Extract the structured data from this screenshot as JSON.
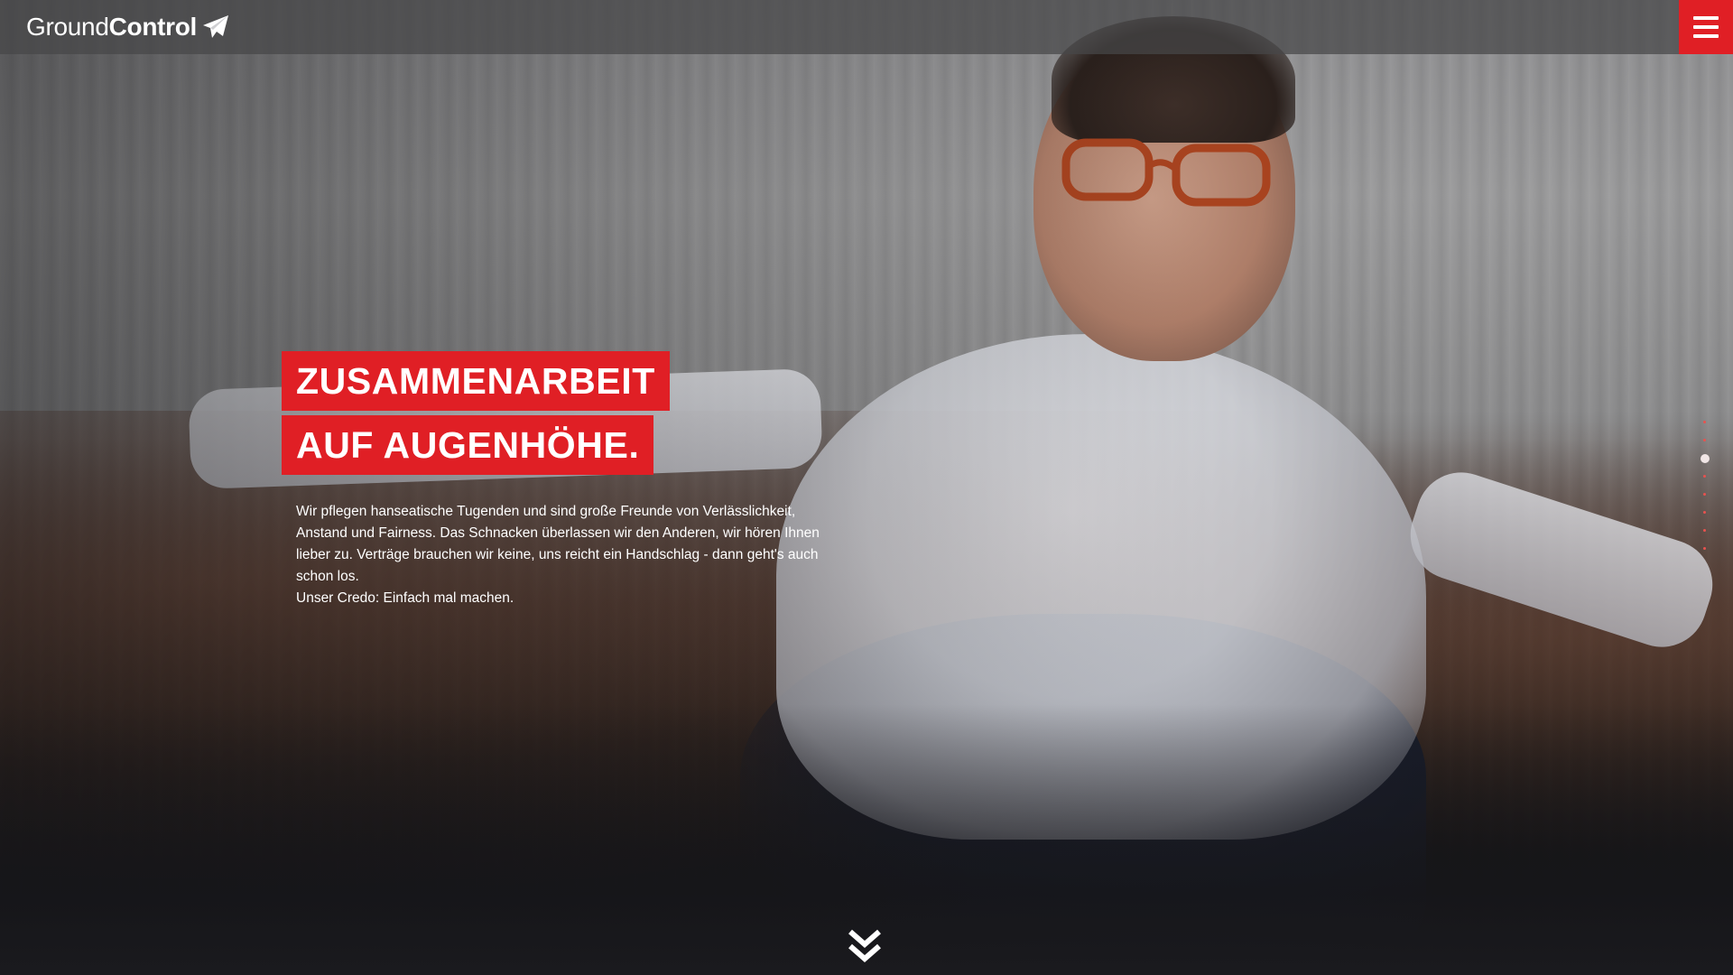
{
  "header": {
    "logo": {
      "light": "Ground",
      "bold": "Control",
      "icon": "paper-plane-icon"
    },
    "menu_icon": "hamburger-menu-icon",
    "accent_color": "#e01f25"
  },
  "hero": {
    "headline": [
      "ZUSAMMENARBEIT",
      "AUF AUGENHÖHE."
    ],
    "body": [
      "Wir pflegen hanseatische Tugenden und sind große Freunde von Verlässlichkeit, Anstand und Fairness. Das Schnacken überlassen wir den Anderen, wir hören Ihnen lieber zu. Verträge brauchen wir keine, uns reicht ein Handschlag - dann geht's auch schon los.",
      "Unser Credo: Einfach mal machen."
    ],
    "scroll_icon": "double-chevron-down-icon"
  },
  "section_nav": {
    "count": 8,
    "active_index": 2
  }
}
